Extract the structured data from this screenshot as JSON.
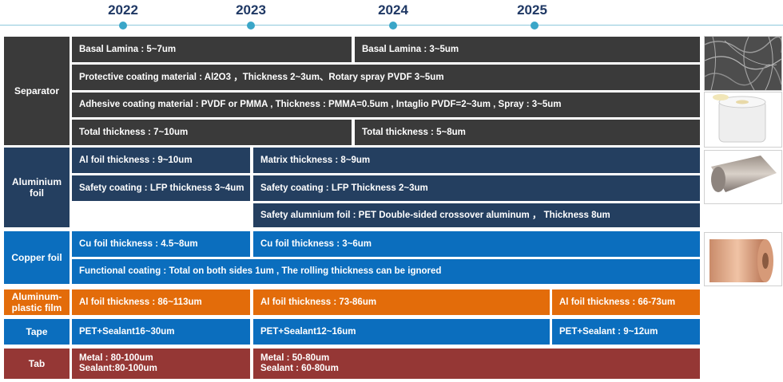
{
  "timeline": {
    "years": [
      "2022",
      "2023",
      "2024",
      "2025"
    ]
  },
  "categories": {
    "separator": "Separator",
    "aluminium_foil": "Aluminium foil",
    "copper_foil": "Copper foil",
    "aluminum_plastic_film": "Aluminum-plastic film",
    "tape": "Tape",
    "tab": "Tab"
  },
  "separator": {
    "basal_1": "Basal Lamina : 5~7um",
    "basal_2": "Basal Lamina : 3~5um",
    "protective": "Protective coating material : Al2O3 ，Thickness 2~3um、Rotary spray PVDF 3~5um",
    "adhesive": "Adhesive coating material : PVDF or PMMA , Thickness : PMMA=0.5um , Intaglio PVDF=2~3um , Spray : 3~5um",
    "total_1": "Total thickness : 7~10um",
    "total_2": "Total thickness : 5~8um"
  },
  "aluminium_foil": {
    "thickness": "Al foil thickness : 9~10um",
    "safety_lfp": "Safety coating : LFP thickness 3~4um",
    "matrix": "Matrix thickness : 8~9um",
    "safety_lfp_2": "Safety coating : LFP Thickness 2~3um",
    "safety_foil": "Safety alumnium foil : PET Double-sided crossover aluminum ， Thickness 8um"
  },
  "copper_foil": {
    "thickness_1": "Cu foil  thickness : 4.5~8um",
    "thickness_2": "Cu foil thickness : 3~6um",
    "functional": "Functional coating : Total on both sides 1um , The rolling thickness can be ignored"
  },
  "aluminum_plastic_film": {
    "t1": "Al foil thickness : 86~113um",
    "t2": "Al foil thickness : 73-86um",
    "t3": "Al foil  thickness : 66-73um"
  },
  "tape": {
    "t1": "PET+Sealant16~30um",
    "t2": "PET+Sealant12~16um",
    "t3": "PET+Sealant : 9~12um"
  },
  "tab": {
    "t1_metal": "Metal : 80-100um",
    "t1_sealant": "Sealant:80-100um",
    "t2_metal": "Metal : 50-80um",
    "t2_sealant": "Sealant : 60-80um"
  },
  "colors": {
    "separator": "#3a3a3a",
    "aluminium_foil": "#243f60",
    "copper_foil": "#0b6ebe",
    "aluminum_plastic_film": "#e36c0a",
    "tape": "#0b6ebe",
    "tab": "#953735",
    "timeline": "#3aa6c8"
  }
}
